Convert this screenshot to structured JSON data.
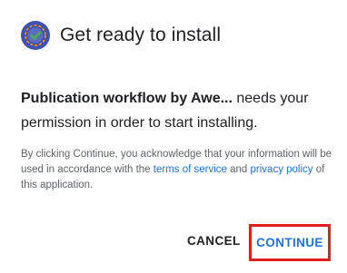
{
  "dialog": {
    "title": "Get ready to install",
    "app_name": "Publication workflow by Awe...",
    "permission_text": " needs your permission in order to start installing.",
    "legal_prefix": "By clicking Continue, you acknowledge that your information will be used in accordance with the ",
    "terms_link": "terms of service",
    "legal_and": " and ",
    "privacy_link": "privacy policy",
    "legal_suffix": " of this application.",
    "cancel_label": "CANCEL",
    "continue_label": "CONTINUE",
    "icon": "app-logo-icon",
    "colors": {
      "link": "#1a73e8",
      "highlight": "#e01e1e",
      "icon_bg": "#3f51b5",
      "icon_check": "#4caf50"
    }
  }
}
